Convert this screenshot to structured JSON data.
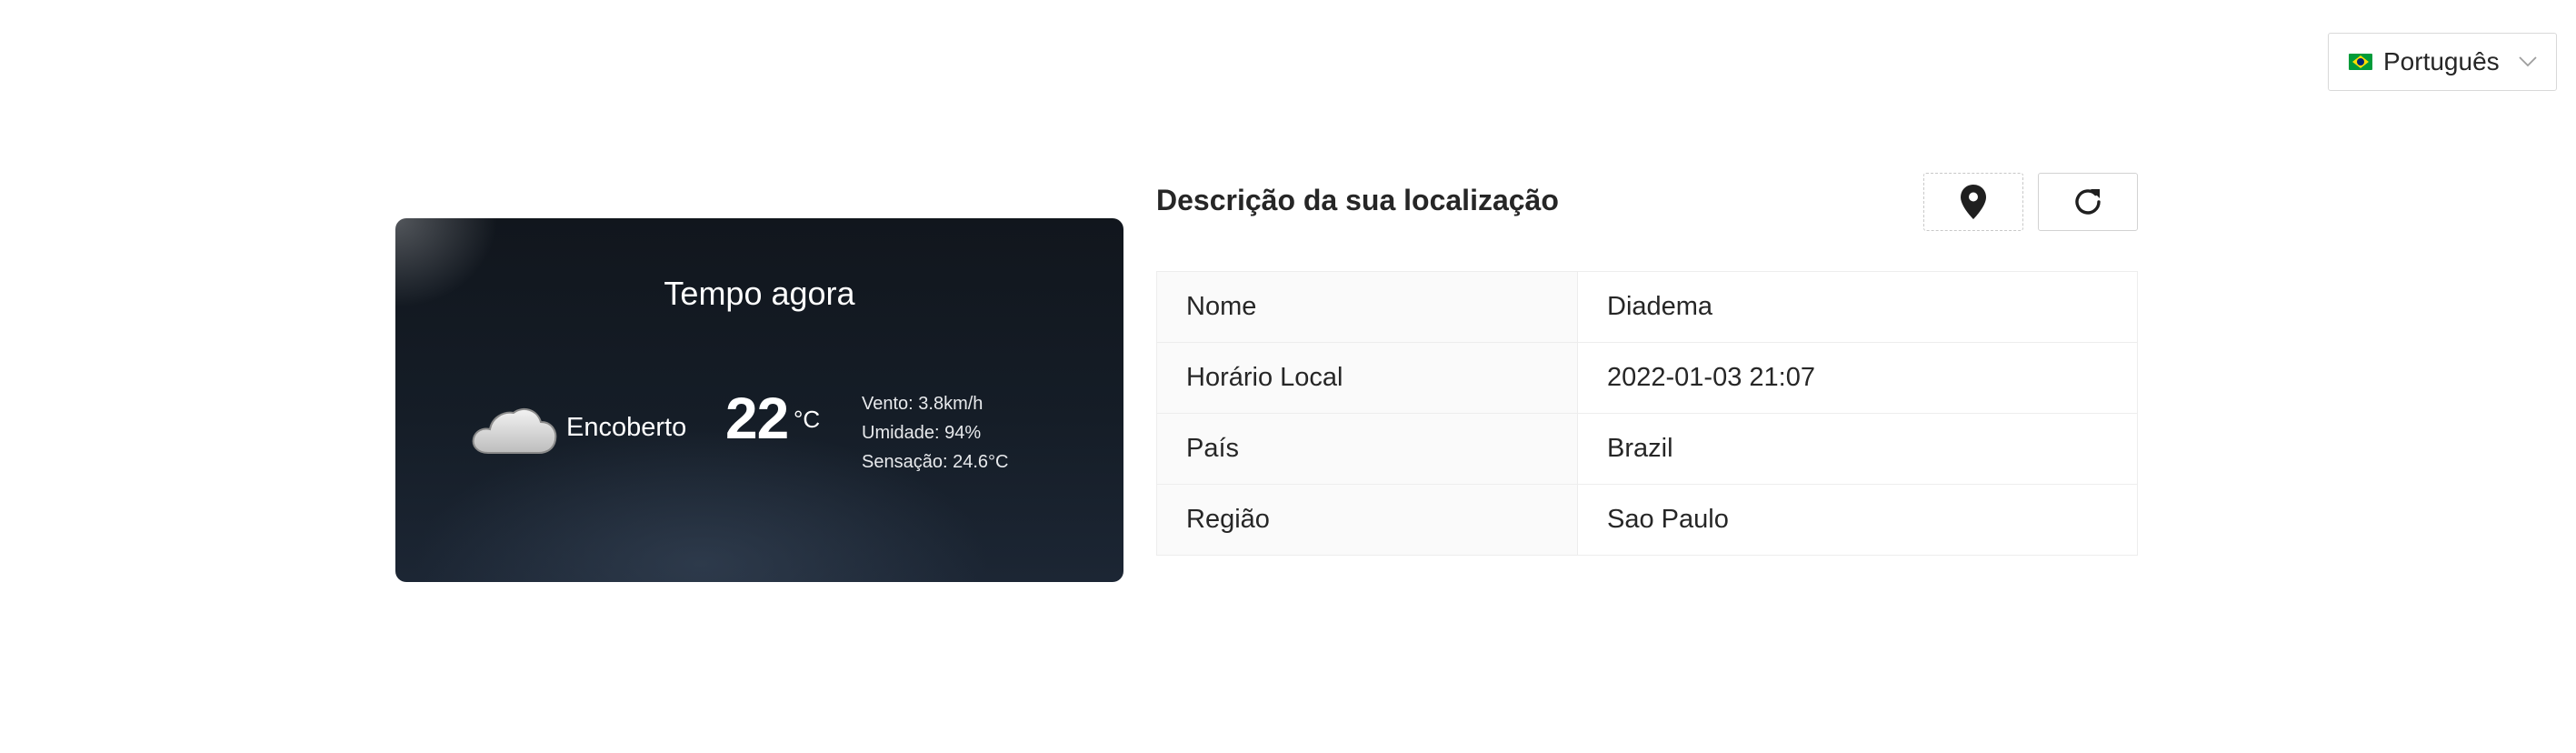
{
  "language_select": {
    "selected": "Português",
    "flag_icon": "brazil-flag-icon"
  },
  "weather": {
    "title": "Tempo agora",
    "icon": "cloud-icon",
    "condition": "Encoberto",
    "temperature": "22",
    "unit": "°C",
    "wind": "Vento: 3.8km/h",
    "humidity": "Umidade: 94%",
    "feels_like": "Sensação: 24.6°C"
  },
  "location": {
    "title": "Descrição da sua localização",
    "buttons": {
      "locate_icon": "map-pin-icon",
      "refresh_icon": "refresh-icon"
    },
    "rows": [
      {
        "label": "Nome",
        "value": "Diadema"
      },
      {
        "label": "Horário Local",
        "value": "2022-01-03 21:07"
      },
      {
        "label": "País",
        "value": "Brazil"
      },
      {
        "label": "Região",
        "value": "Sao Paulo"
      }
    ]
  },
  "colors": {
    "card_background": "#151d27",
    "text": "#262626",
    "border": "#ededed",
    "label_cell_background": "#fafafa"
  }
}
